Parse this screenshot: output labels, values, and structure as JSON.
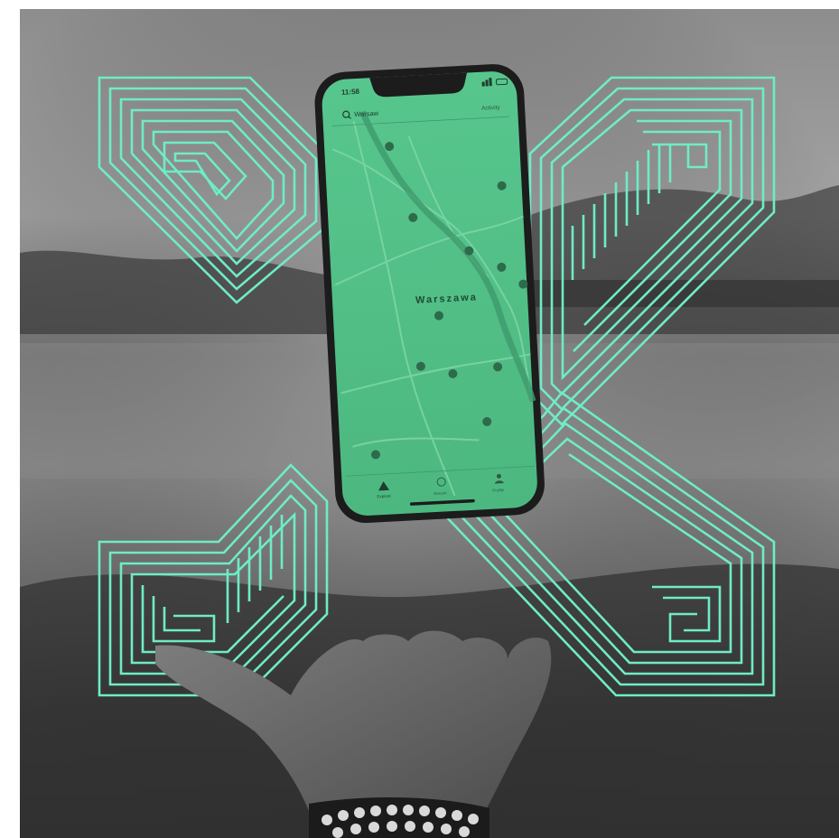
{
  "colors": {
    "accent_line": "#66e8c8",
    "screen_green": "#4fbe85",
    "photo_light": "#9a9a9a",
    "photo_dark": "#2b2b2b",
    "phone_frame": "#1c1c1c"
  },
  "phone": {
    "status_time": "11:58",
    "search_placeholder": "Warsaw",
    "top_right_link": "Activity",
    "map_city_label": "Warszawa",
    "tab_bar": [
      {
        "icon": "explore-icon",
        "label": "Explore"
      },
      {
        "icon": "clock-icon",
        "label": "Recent"
      },
      {
        "icon": "person-icon",
        "label": "Profile"
      }
    ]
  },
  "icons": [
    "search-icon",
    "map-pin-icon",
    "hand-image"
  ]
}
